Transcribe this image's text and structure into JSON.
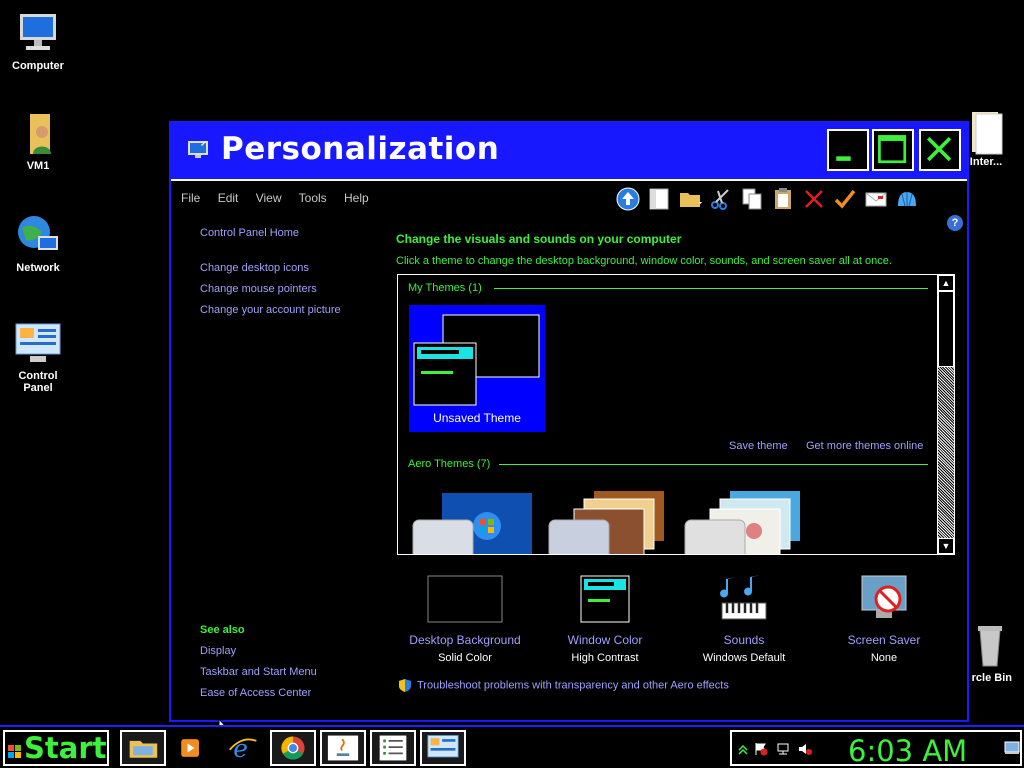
{
  "desktop": {
    "icons": [
      {
        "label": "Computer",
        "icon": "computer-icon"
      },
      {
        "label": "VM1",
        "icon": "user-folder-icon"
      },
      {
        "label": "Network",
        "icon": "network-globe-icon"
      },
      {
        "label": "Control\nPanel",
        "icon": "control-panel-icon"
      }
    ],
    "partial_icons": [
      {
        "label": "Inter...",
        "icon": "internet-folder-icon"
      },
      {
        "label": "rcle Bin",
        "icon": "recycle-bin-icon"
      }
    ]
  },
  "window": {
    "title": "Personalization",
    "controls": {
      "minimize": "minimize-icon",
      "maximize": "maximize-icon",
      "close": "close-icon"
    },
    "menu": [
      "File",
      "Edit",
      "View",
      "Tools",
      "Help"
    ],
    "toolbar_icons": [
      "up-folder-icon",
      "pane-icon",
      "folder-options-icon",
      "cut-icon",
      "copy-icon",
      "paste-icon",
      "delete-icon",
      "checkmark-icon",
      "email-icon",
      "shell-icon"
    ],
    "help_icon": "?"
  },
  "leftnav": {
    "home": "Control Panel Home",
    "links": [
      "Change desktop icons",
      "Change mouse pointers",
      "Change your account picture"
    ],
    "see_also_title": "See also",
    "see_also_links": [
      "Display",
      "Taskbar and Start Menu",
      "Ease of Access Center"
    ]
  },
  "main": {
    "heading": "Change the visuals and sounds on your computer",
    "subheading": "Click a theme to change the desktop background, window color, sounds, and screen saver all at once.",
    "my_themes": {
      "label": "My Themes (1)",
      "theme_name": "Unsaved Theme"
    },
    "save_theme": "Save theme",
    "get_more": "Get more themes online",
    "aero_themes": {
      "label": "Aero Themes (7)"
    }
  },
  "bottom": {
    "items": [
      {
        "title": "Desktop Background",
        "value": "Solid Color",
        "icon": "desktop-background-icon"
      },
      {
        "title": "Window Color",
        "value": "High Contrast",
        "icon": "window-color-icon"
      },
      {
        "title": "Sounds",
        "value": "Windows Default",
        "icon": "sounds-icon"
      },
      {
        "title": "Screen Saver",
        "value": "None",
        "icon": "screen-saver-icon"
      }
    ],
    "troubleshoot": "Troubleshoot problems with transparency and other Aero effects"
  },
  "taskbar": {
    "start_label": "Start",
    "apps": [
      "file-explorer-icon",
      "media-player-icon",
      "internet-explorer-icon",
      "chrome-icon",
      "java-icon",
      "task-list-icon",
      "control-panel-icon"
    ],
    "clock": "6:03 AM"
  },
  "colors": {
    "accent_blue": "#1818ff",
    "accent_green": "#3cf03c",
    "link_lavender": "#a0a0ff"
  }
}
